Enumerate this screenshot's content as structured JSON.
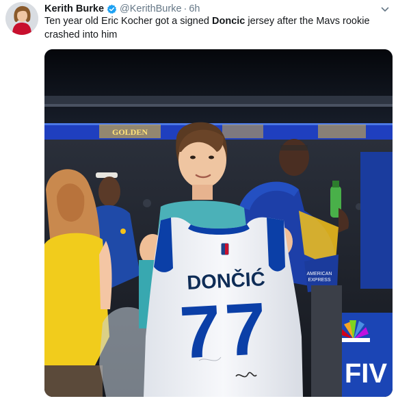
{
  "author": {
    "display_name": "Kerith Burke",
    "handle": "@KerithBurke",
    "separator": "·",
    "time_ago": "6h"
  },
  "tweet": {
    "text_before": "Ten year old Eric Kocher got a signed ",
    "text_bold": "Doncic",
    "text_after": " jersey after the Mavs rookie crashed into him"
  },
  "photo": {
    "banner_text": "GOLDEN",
    "jersey_name": "DONČIĆ",
    "jersey_number": "77",
    "sign_text_1": "AMERICAN",
    "sign_text_2": "EXPRESS",
    "sponsor_text": "FIV"
  },
  "icons": {
    "verified": "verified-badge-icon",
    "caret": "chevron-down-icon"
  },
  "colors": {
    "verified_blue": "#1da1f2",
    "secondary_text": "#657786",
    "jersey_blue": "#0b3fa7"
  }
}
